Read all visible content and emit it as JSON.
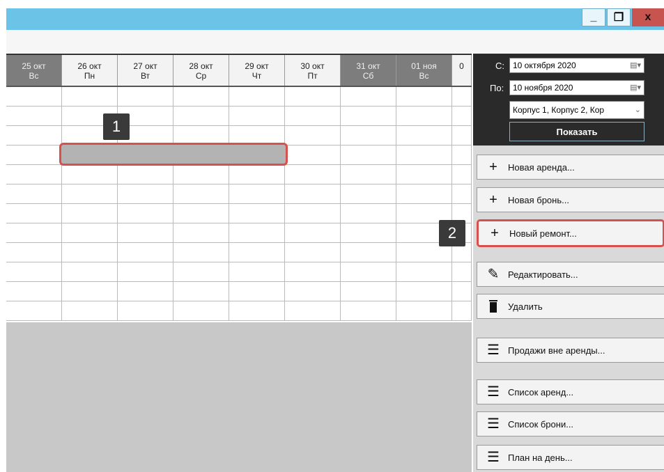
{
  "window": {
    "controls": {
      "minimize": "_",
      "maximize": "❐",
      "close": "x"
    }
  },
  "calendar": {
    "days": [
      {
        "date": "25 окт",
        "weekday": "Вс",
        "weekend": true
      },
      {
        "date": "26 окт",
        "weekday": "Пн",
        "weekend": false
      },
      {
        "date": "27 окт",
        "weekday": "Вт",
        "weekend": false
      },
      {
        "date": "28 окт",
        "weekday": "Ср",
        "weekend": false
      },
      {
        "date": "29 окт",
        "weekday": "Чт",
        "weekend": false
      },
      {
        "date": "30 окт",
        "weekday": "Пт",
        "weekend": false
      },
      {
        "date": "31 окт",
        "weekday": "Сб",
        "weekend": true
      },
      {
        "date": "01 ноя",
        "weekday": "Вс",
        "weekend": true
      },
      {
        "date": "0",
        "weekday": "",
        "weekend": false
      }
    ]
  },
  "callouts": {
    "one": "1",
    "two": "2"
  },
  "filters": {
    "from_label": "С:",
    "from_value": "10 октября  2020",
    "to_label": "По:",
    "to_value": "10  ноября  2020",
    "buildings_value": "Корпус 1, Корпус 2, Кор",
    "show_label": "Показать"
  },
  "actions": [
    {
      "label": "Новая аренда...",
      "icon": "plus-icon"
    },
    {
      "label": "Новая бронь...",
      "icon": "plus-icon"
    },
    {
      "label": "Новый ремонт...",
      "icon": "plus-icon"
    },
    {
      "label": "Редактировать...",
      "icon": "pencil-icon"
    },
    {
      "label": "Удалить",
      "icon": "trash-icon"
    },
    {
      "label": "Продажи вне аренды...",
      "icon": "list-icon"
    },
    {
      "label": "Список аренд...",
      "icon": "list-icon"
    },
    {
      "label": "Список брони...",
      "icon": "list-icon"
    },
    {
      "label": "План на день...",
      "icon": "list-icon"
    }
  ],
  "colors": {
    "titlebar": "#6cc3e8",
    "highlight": "#d8504e",
    "weekend_header": "#7d7d7d",
    "panel_dark": "#2a2a2a"
  }
}
